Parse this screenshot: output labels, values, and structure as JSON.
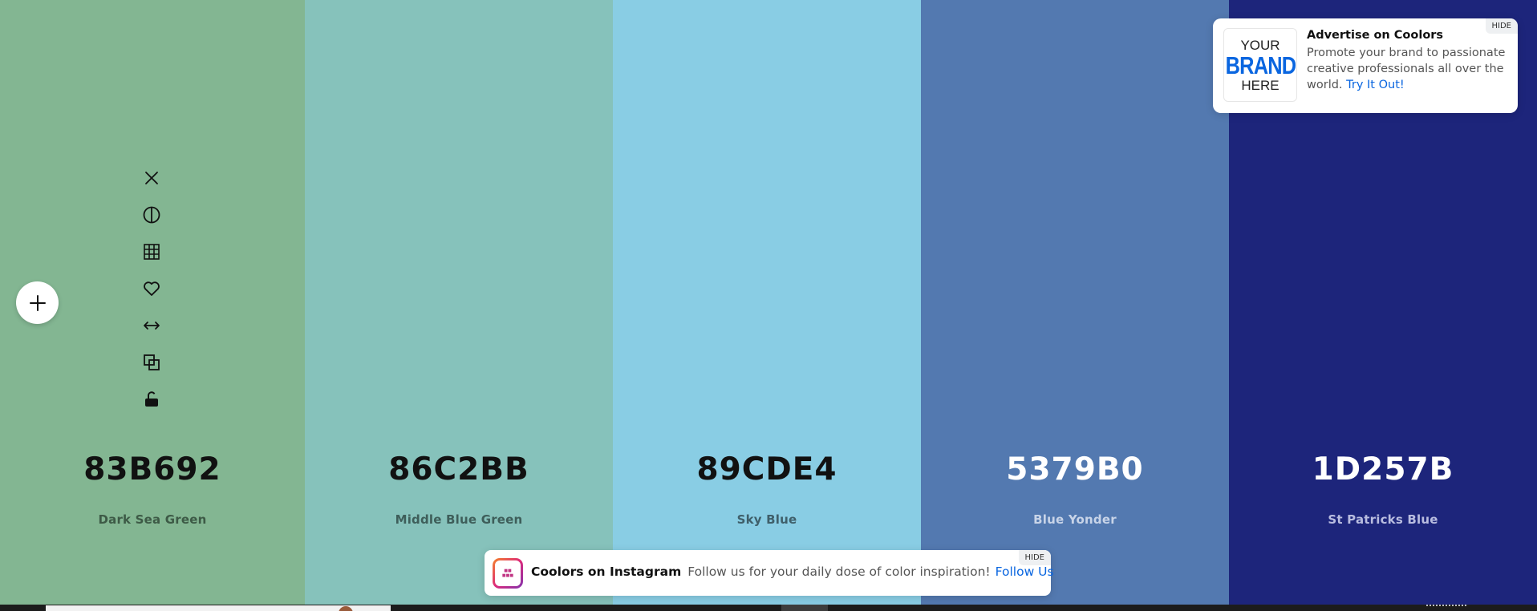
{
  "palette": [
    {
      "hex": "83B692",
      "name": "Dark Sea Green",
      "bg": "#83B692",
      "text_color": "#111111",
      "name_color": "#3d5a46"
    },
    {
      "hex": "86C2BB",
      "name": "Middle Blue Green",
      "bg": "#86C2BB",
      "text_color": "#111111",
      "name_color": "#3e5e5a"
    },
    {
      "hex": "89CDE4",
      "name": "Sky Blue",
      "bg": "#89CDE4",
      "text_color": "#111111",
      "name_color": "#3f5f6a"
    },
    {
      "hex": "5379B0",
      "name": "Blue Yonder",
      "bg": "#5379B0",
      "text_color": "#ffffff",
      "name_color": "#c8d4e8"
    },
    {
      "hex": "1D257B",
      "name": "St Patricks Blue",
      "bg": "#1D257B",
      "text_color": "#ffffff",
      "name_color": "#b9bde0"
    }
  ],
  "tools": [
    "close-icon",
    "contrast-icon",
    "grid-icon",
    "heart-icon",
    "drag-arrows-icon",
    "copy-icon",
    "unlock-icon"
  ],
  "add_button_icon": "plus-icon",
  "ad": {
    "logo_line1": "YOUR",
    "logo_line2": "BRAND",
    "logo_line3": "HERE",
    "title": "Advertise on Coolors",
    "body": "Promote your brand to passionate creative professionals all over the world.",
    "link": "Try It Out!",
    "hide": "HIDE"
  },
  "instagram": {
    "title": "Coolors on Instagram",
    "description": "Follow us for your daily dose of color inspiration!",
    "link": "Follow Us",
    "hide": "HIDE"
  }
}
